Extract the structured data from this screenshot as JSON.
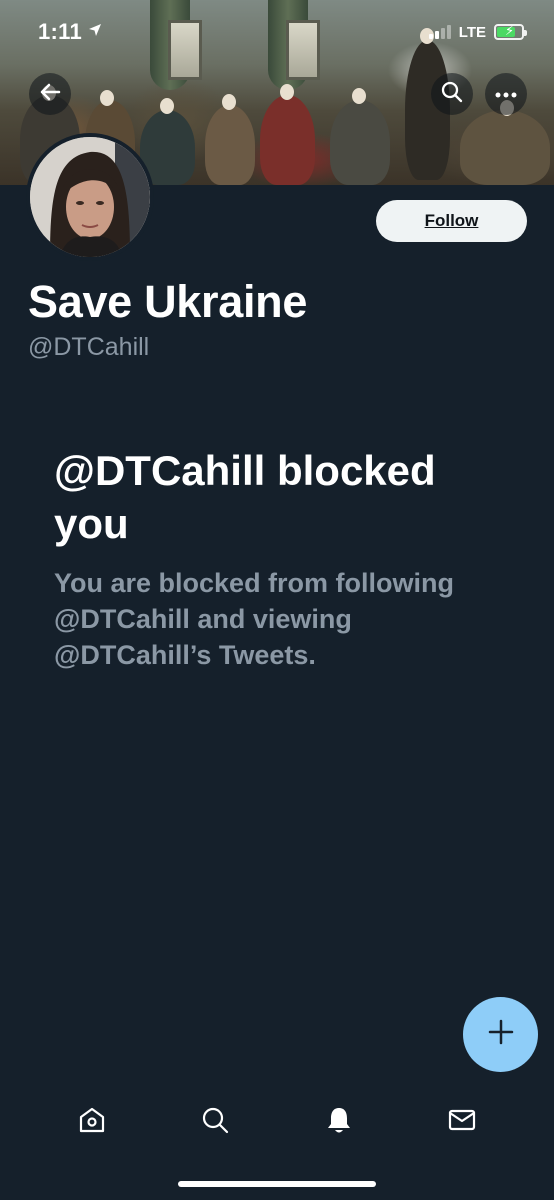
{
  "status_bar": {
    "time": "1:11",
    "network": "LTE"
  },
  "profile": {
    "display_name": "Save Ukraine",
    "handle": "@DTCahill",
    "follow_label": "Follow"
  },
  "blocked": {
    "title": "@DTCahill blocked you",
    "message": "You are blocked from following @DTCahill and viewing @DTCahill’s Tweets."
  },
  "icons": {
    "back": "back-arrow-icon",
    "search": "search-icon",
    "more": "more-icon",
    "compose": "compose-plus-icon",
    "home": "home-icon",
    "explore": "search-icon",
    "notifications": "bell-icon",
    "messages": "mail-icon"
  },
  "colors": {
    "background": "#15202b",
    "secondary_text": "#8b98a5",
    "fab": "#8ecdf8",
    "follow_button": "#eff3f4",
    "battery": "#4cd964"
  },
  "battery_level": 0.75
}
